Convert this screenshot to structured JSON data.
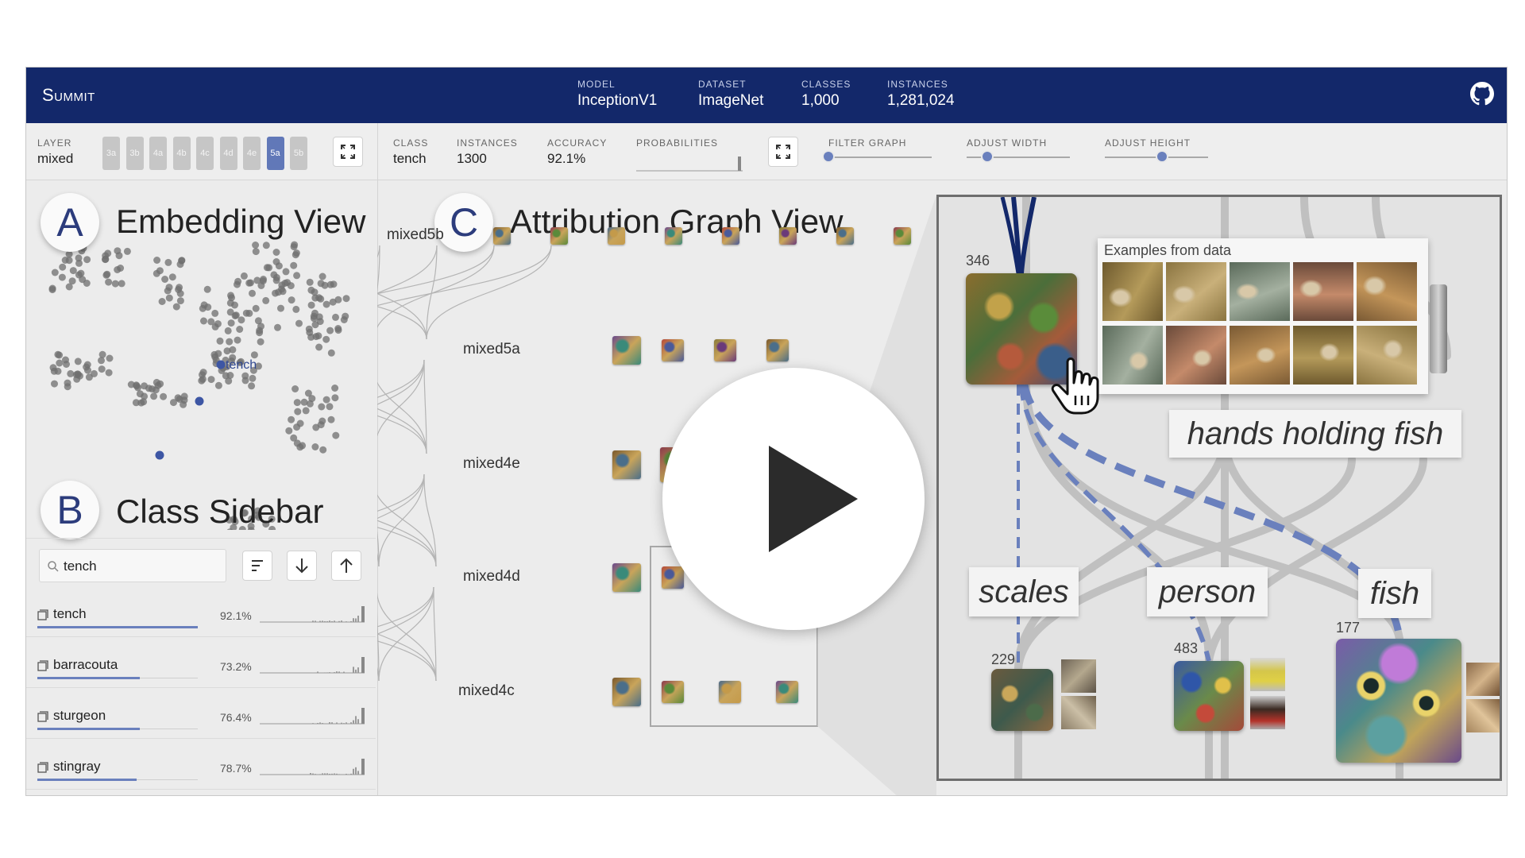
{
  "header": {
    "brand": "Summit",
    "stats": [
      {
        "label": "MODEL",
        "value": "InceptionV1"
      },
      {
        "label": "DATASET",
        "value": "ImageNet"
      },
      {
        "label": "CLASSES",
        "value": "1,000"
      },
      {
        "label": "INSTANCES",
        "value": "1,281,024"
      }
    ],
    "github_icon": "github-icon"
  },
  "toolbar": {
    "layer": {
      "label": "LAYER",
      "value": "mixed"
    },
    "layer_buttons": [
      "3a",
      "3b",
      "4a",
      "4b",
      "4c",
      "4d",
      "4e",
      "5a",
      "5b"
    ],
    "active_layer": "5a",
    "class": {
      "label": "CLASS",
      "value": "tench"
    },
    "instances": {
      "label": "INSTANCES",
      "value": "1300"
    },
    "accuracy": {
      "label": "ACCURACY",
      "value": "92.1%"
    },
    "probabilities": {
      "label": "PROBABILITIES"
    },
    "filter_graph": {
      "label": "FILTER GRAPH",
      "level": 0.0
    },
    "adjust_width": {
      "label": "ADJUST WIDTH",
      "level": 0.2
    },
    "adjust_height": {
      "label": "ADJUST HEIGHT",
      "level": 0.55
    }
  },
  "embedding": {
    "badge": "A",
    "title": "Embedding View",
    "highlight_label": "tench"
  },
  "sidebar": {
    "badge": "B",
    "title": "Class Sidebar",
    "search_value": "tench",
    "classes": [
      {
        "name": "tench",
        "accuracy": "92.1%",
        "bar": 1.0
      },
      {
        "name": "barracouta",
        "accuracy": "73.2%",
        "bar": 0.64
      },
      {
        "name": "sturgeon",
        "accuracy": "76.4%",
        "bar": 0.64
      },
      {
        "name": "stingray",
        "accuracy": "78.7%",
        "bar": 0.62
      }
    ]
  },
  "graph": {
    "badge": "C",
    "title": "Attribution Graph View",
    "layers": [
      "mixed5b",
      "mixed5a",
      "mixed4e",
      "mixed4d",
      "mixed4c"
    ]
  },
  "zoom": {
    "popup_title": "Examples from data",
    "top_channel": "346",
    "callouts": [
      "hands holding fish",
      "scales",
      "person",
      "fish"
    ],
    "channels": [
      "229",
      "483",
      "177"
    ]
  },
  "colors": {
    "header": "#13286a",
    "accent": "#6a80bd",
    "edge_highlight": "#6a80bd"
  },
  "icons": {
    "play": "play-icon",
    "search": "search-icon",
    "class_item": "image-icon",
    "expand": "expand-icon",
    "sort": "sort-icon",
    "arrow_down": "arrow-down-icon",
    "arrow_up": "arrow-up-icon",
    "cursor": "hand-cursor-icon"
  }
}
